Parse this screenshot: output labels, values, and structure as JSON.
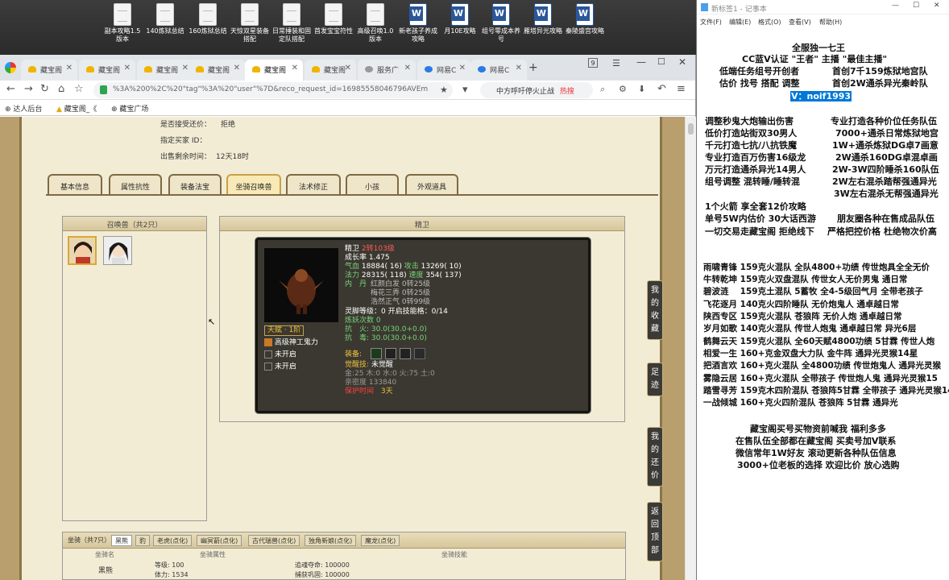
{
  "desktop": {
    "icons": [
      "副本攻略1.5版本",
      "140炼狱总结",
      "160炼狱总结",
      "天惊双星装备搭配",
      "日常捶装和固定队搭配",
      "首发宝宝符性",
      "高级召唤1.0版本",
      "新老孩子养成攻略",
      "月10E攻略",
      "组号零成本养号",
      "雁塔异光攻略",
      "秦陵盛宫攻略"
    ]
  },
  "browser": {
    "tabs": [
      "藏宝阁",
      "藏宝阁",
      "藏宝阁",
      "藏宝阁",
      "藏宝阁",
      "藏宝阁",
      "服务广",
      "网易C",
      "网易C"
    ],
    "tab_count": "9",
    "url": "%3A%200%2C%20\"tag\"%3A%20\"user\"%7D&reco_request_id=16985558046796AVEm",
    "search_text": "中方呼吁停火止战",
    "search_badge": "热搜",
    "bookmarks": [
      "达人后台",
      "藏宝阁_《",
      "藏宝广场"
    ]
  },
  "trade": {
    "accept_offer_label": "是否接受还价：",
    "accept_offer_value": "拒绝",
    "buyer_label": "指定买家 ID：",
    "buyer_value": "",
    "remaining_label": "出售剩余时间：",
    "remaining_value": "12天18时"
  },
  "game_tabs": [
    "基本信息",
    "属性抗性",
    "装备法宝",
    "坐骑召唤兽",
    "法术修正",
    "小孩",
    "外观道具"
  ],
  "pet_list": {
    "title": "召唤兽（共2只）"
  },
  "pet": {
    "title": "精卫",
    "name": "精卫",
    "level": "2转103级",
    "growth": "成长率 1.475",
    "hp_label": "气血",
    "hp": "18884( 16)",
    "atk_label": "攻击",
    "atk": "13269( 10)",
    "mp_label": "法力",
    "mp": "28315( 118)",
    "spd_label": "速度",
    "spd": "354( 137)",
    "neidan_label": "内　丹",
    "neidan": [
      "红颜白发 0转25级",
      "梅花三弄 0转25级",
      "浩然正气 0转99级"
    ],
    "talent": "天赋 · 1阶",
    "skills": [
      "高级神工鬼力",
      "未开启",
      "未开启"
    ],
    "spirit": "灵脚等级：0 开启技能格：0/14",
    "refine": "炼妖次数 0",
    "fire_res": "抗　火: 30.0(30.0+0.0)",
    "water_res": "抗　毒: 30.0(30.0+0.0)",
    "equip_label": "装备:",
    "awaken_label": "觉醒技:",
    "awaken_value": "未觉醒",
    "elements": "金:25 木:0 水:0 火:75 土:0",
    "intimacy": "亲密度 133840",
    "protect_label": "保护时间",
    "protect_value": "3天"
  },
  "mount": {
    "title": "坐骑（共7只）",
    "tabs": [
      "黑熊",
      "豹",
      "老虎(点化)",
      "幽冥箭(点化)",
      "古代瑞兽(点化)",
      "独角新娘(点化)",
      "魔龙(点化)"
    ],
    "headers": [
      "坐骑名",
      "坐骑属性",
      "坐骑技能"
    ],
    "name": "黑熊",
    "level_label": "等级:",
    "level": "100",
    "hp_label": "体力:",
    "hp": "1534",
    "life_label": "追魂夺命:",
    "life": "100000",
    "skill2_label": "捕获巩固:",
    "skill2": "100000"
  },
  "side_buttons": [
    "我的收藏",
    "足迹",
    "我的还价",
    "返回顶部"
  ],
  "notepad": {
    "title": "新标签1 - 记事本",
    "menu": [
      "文件(F)",
      "编辑(E)",
      "格式(O)",
      "查看(V)",
      "帮助(H)"
    ],
    "header": [
      "全服独一七王",
      "CC蓝V认证 \"王者\" 主播 \"最佳主播\"",
      "低端任务组号开创者",
      "首创7千159炼狱地宫队",
      "估价 找号 搭配 调整",
      "首创2W通杀异光秦岭队",
      "V：noif1993"
    ],
    "services_left": [
      "调整秒鬼大炮输出伤害",
      "低价打造站街双30男人",
      "千元打造七抗/八抗铁魔",
      "专业打造百万伤害16级龙",
      "万元打造通杀异光14男人",
      "组号调整 混转睡/睡转混"
    ],
    "services_right": [
      "专业打造各种价位任务队伍",
      "7000+通杀日常炼狱地宫",
      "1W+通杀炼狱DG卓7画意",
      "2W通杀160DG卓混卓画",
      "2W-3W四阶睡杀160队伍",
      "2W左右混杀踏帮强通异光",
      "3W左右混杀无帮强通异光"
    ],
    "misc": [
      "1个火箭 享全套12价攻略",
      "单号5W内估价 30大话西游",
      "朋友圈各种在售成品队伍",
      "一切交易走藏宝阁 拒绝线下",
      "严格把控价格 杜绝物次价高"
    ],
    "teams": [
      "雨啸青锋 159克火混队 全队4800+功绩 传世炮具全全无价",
      "牛转乾坤 159克火双盘混队 传世女人无价男鬼 通日常",
      "碧波涟　 159克土混队 5蓄牧 全4-5级回气月 全带老孩子",
      "飞花逐月 140克火四阶睡队 无价炮鬼人 通卓越日常",
      "陕西专区 159克火混队 苍狼阵 无价人炮 通卓越日常",
      "岁月如歌 140克火混队 传世人炮鬼 通卓越日常 异光6层",
      "鹤舞云天 159克火混队 全60天赋4800功绩 5甘霖 传世人炮",
      "相爱一生 160+克金双盘大力队 金牛阵 通异光灵猴14星",
      "把酒言欢 160+克火混队 全4800功绩 传世炮鬼人 通异光灵猴",
      "雾隐云居 160+克火混队 全带孩子 传世炮人鬼 通异光灵猴15",
      "踏雪寻芳 159克木四阶混队 苍狼阵5甘霖 全带孩子 通异光灵猴14",
      "一战倾城 160+克火四阶混队 苍狼阵 5甘霖 通异光"
    ],
    "footer": [
      "藏宝阁买号买物资前喊我 福利多多",
      "在售队伍全部都在藏宝阁 买卖号加V联系",
      "微信常年1W好友 滚动更新各种队伍信息",
      "3000+位老板的选择 欢迎比价 放心选购"
    ]
  }
}
